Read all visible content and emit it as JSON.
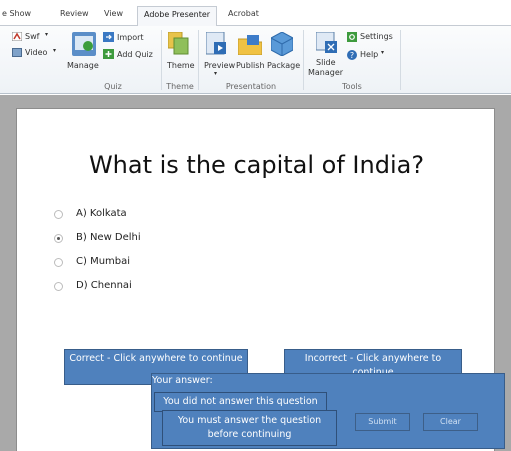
{
  "ribbon": {
    "tabs": [
      "e Show",
      "Review",
      "View",
      "Adobe Presenter",
      "Acrobat"
    ],
    "active_tab": "Adobe Presenter",
    "items": {
      "swf": "Swf",
      "video": "Video",
      "manage": "Manage",
      "import": "Import",
      "add_quiz": "Add Quiz",
      "theme": "Theme",
      "preview": "Preview",
      "publish": "Publish",
      "package": "Package",
      "slide_manager_line1": "Slide",
      "slide_manager_line2": "Manager",
      "settings": "Settings",
      "help": "Help"
    },
    "groups": {
      "quiz": "Quiz",
      "theme": "Theme",
      "presentation": "Presentation",
      "tools": "Tools"
    }
  },
  "slide": {
    "question": "What is the capital of India?",
    "options": [
      {
        "label": "A)  Kolkata",
        "selected": false
      },
      {
        "label": "B)  New Delhi",
        "selected": true
      },
      {
        "label": "C)  Mumbai",
        "selected": false
      },
      {
        "label": "D)  Chennai",
        "selected": false
      }
    ],
    "correct_feedback": "Correct - Click anywhere to continue",
    "incorrect_feedback": "Incorrect - Click anywhere to continue",
    "your_answer_label": "Your answer:",
    "not_answered": "You did not answer this question",
    "must_answer": "You must answer the question before continuing",
    "submit": "Submit",
    "clear": "Clear"
  },
  "colors": {
    "accent": "#4f81bd",
    "accent_border": "#385d8a",
    "ribbon_bg": "#eef2f6",
    "canvas_bg": "#a9a9a9"
  }
}
